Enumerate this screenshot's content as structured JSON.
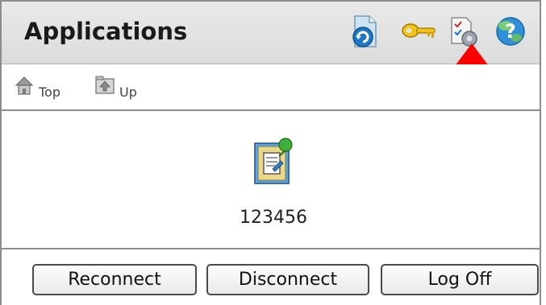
{
  "header": {
    "title": "Applications",
    "icons": [
      "refresh-icon",
      "key-icon",
      "preferences-icon",
      "help-icon"
    ]
  },
  "nav": {
    "top_label": "Top",
    "up_label": "Up"
  },
  "apps": [
    {
      "label": "123456",
      "icon": "published-app-icon"
    }
  ],
  "footer": {
    "reconnect_label": "Reconnect",
    "disconnect_label": "Disconnect",
    "logoff_label": "Log Off"
  },
  "colors": {
    "header_bg": "#e3e3e3",
    "arrow": "#ff0000",
    "border": "#8c8c8c"
  }
}
